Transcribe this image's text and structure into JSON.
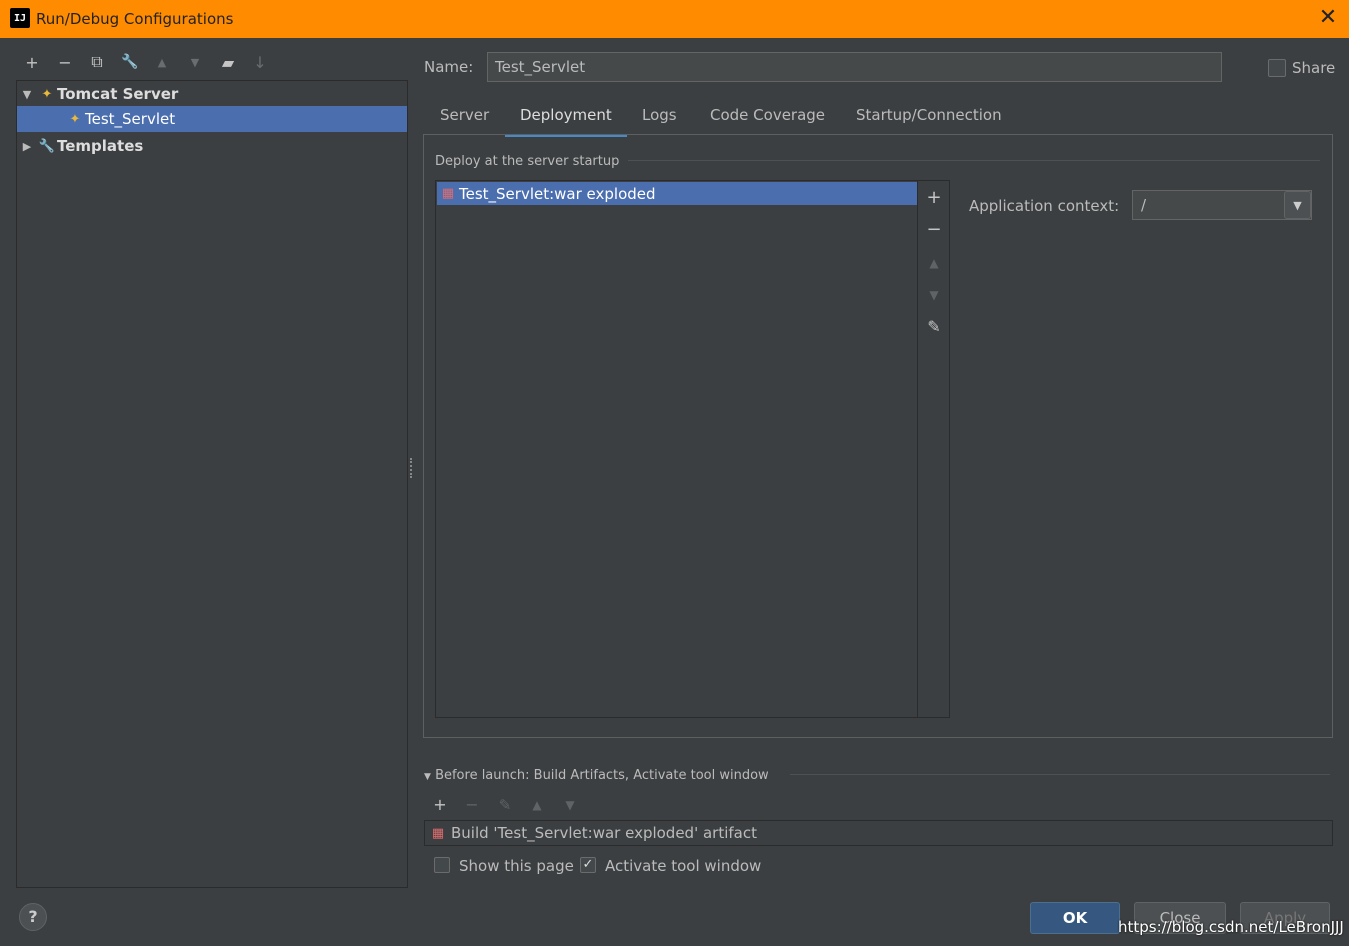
{
  "window": {
    "title": "Run/Debug Configurations",
    "app_icon_text": "IJ",
    "close_glyph": "✕",
    "accent_color": "#ff8c00"
  },
  "left_toolbar": [
    {
      "name": "add-configuration-button",
      "icon": "plus-icon",
      "glyph": "+",
      "enabled": true
    },
    {
      "name": "remove-configuration-button",
      "icon": "minus-icon",
      "glyph": "−",
      "enabled": true
    },
    {
      "name": "copy-configuration-button",
      "icon": "copy-icon",
      "glyph": "⧉",
      "enabled": true
    },
    {
      "name": "edit-defaults-button",
      "icon": "wrench-icon",
      "glyph": "🔧",
      "enabled": true
    },
    {
      "name": "move-up-button",
      "icon": "arrow-up-icon",
      "glyph": "▲",
      "enabled": false
    },
    {
      "name": "move-down-button",
      "icon": "arrow-down-icon",
      "glyph": "▼",
      "enabled": false
    },
    {
      "name": "new-folder-button",
      "icon": "folder-add-icon",
      "glyph": "▰",
      "enabled": true
    },
    {
      "name": "sort-button",
      "icon": "sort-icon",
      "glyph": "↓",
      "enabled": false
    }
  ],
  "tree": {
    "group": {
      "label": "Tomcat Server",
      "expanded": true
    },
    "child": {
      "label": "Test_Servlet"
    },
    "templates": {
      "label": "Templates",
      "expanded": false
    }
  },
  "name_field": {
    "label": "Name:",
    "value": "Test_Servlet"
  },
  "share": {
    "label": "Share",
    "checked": false
  },
  "tabs": [
    {
      "label": "Server",
      "active": false
    },
    {
      "label": "Deployment",
      "active": true
    },
    {
      "label": "Logs",
      "active": false
    },
    {
      "label": "Code Coverage",
      "active": false
    },
    {
      "label": "Startup/Connection",
      "active": false
    }
  ],
  "deployment": {
    "group_title": "Deploy at the server startup",
    "items": [
      "Test_Servlet:war exploded"
    ],
    "context_label": "Application context:",
    "context_value": "/"
  },
  "before_launch": {
    "title": "Before launch: Build Artifacts, Activate tool window",
    "task": "Build 'Test_Servlet:war exploded' artifact",
    "show_page": {
      "label": "Show this page",
      "checked": false
    },
    "activate_window": {
      "label": "Activate tool window",
      "checked": true
    }
  },
  "buttons": {
    "help": "?",
    "ok": "OK",
    "close": "Close",
    "apply": "Apply"
  },
  "watermark": "https://blog.csdn.net/LeBronJJJ"
}
